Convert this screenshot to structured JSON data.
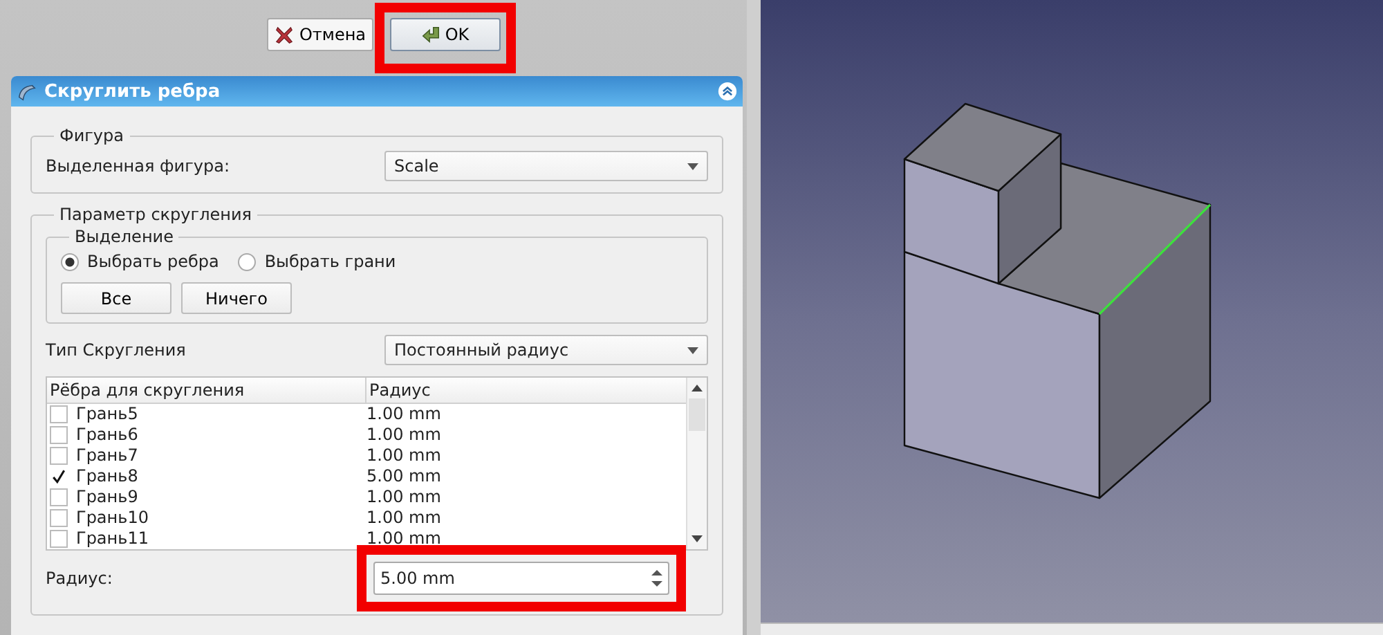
{
  "dialog_buttons": [
    {
      "kind": "cancel",
      "label": "Отмена",
      "highlighted": false
    },
    {
      "kind": "ok",
      "label": "OK",
      "highlighted": true
    }
  ],
  "panel": {
    "title": "Скруглить ребра",
    "shape_group": {
      "title": "Фигура",
      "label": "Выделенная фигура:",
      "value": "Scale"
    },
    "params_group": {
      "title": "Параметр скругления",
      "selection_group": {
        "title": "Выделение",
        "radios": [
          {
            "label": "Выбрать ребра",
            "selected": true
          },
          {
            "label": "Выбрать грани",
            "selected": false
          }
        ],
        "buttons": [
          "Все",
          "Ничего"
        ]
      },
      "type_label": "Тип Скругления",
      "type_value": "Постоянный радиус",
      "table": {
        "columns": [
          "Рёбра для скругления",
          "Радиус"
        ],
        "rows": [
          {
            "name": "Грань5",
            "radius": "1.00 mm",
            "checked": false
          },
          {
            "name": "Грань6",
            "radius": "1.00 mm",
            "checked": false
          },
          {
            "name": "Грань7",
            "radius": "1.00 mm",
            "checked": false
          },
          {
            "name": "Грань8",
            "radius": "5.00 mm",
            "checked": true
          },
          {
            "name": "Грань9",
            "radius": "1.00 mm",
            "checked": false
          },
          {
            "name": "Грань10",
            "radius": "1.00 mm",
            "checked": false
          },
          {
            "name": "Грань11",
            "radius": "1.00 mm",
            "checked": false
          }
        ]
      },
      "radius_label": "Радиус:",
      "radius_value": "5.00 mm",
      "radius_highlighted": true
    }
  }
}
